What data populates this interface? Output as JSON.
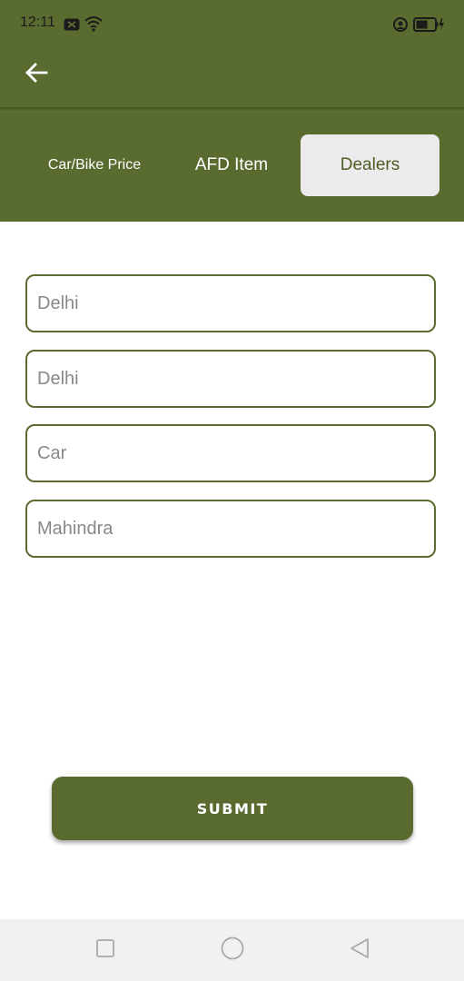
{
  "status_bar": {
    "time": "12:11",
    "icons": [
      "notification-badge-icon",
      "wifi-icon",
      "alarm-icon",
      "battery-icon"
    ]
  },
  "app_bar": {
    "back_icon": "arrow-left-icon"
  },
  "tabs": [
    {
      "label": "Car/Bike Price",
      "selected": false
    },
    {
      "label": "AFD Item",
      "selected": false
    },
    {
      "label": "Dealers",
      "selected": true
    }
  ],
  "form": {
    "fields": [
      {
        "value": "Delhi"
      },
      {
        "value": "Delhi"
      },
      {
        "value": "Car"
      },
      {
        "value": "Mahindra"
      }
    ],
    "submit_label": "SUBMIT"
  },
  "nav_bar": {
    "icons": [
      "recents-square-icon",
      "home-circle-icon",
      "back-triangle-icon"
    ]
  },
  "colors": {
    "primary": "#5a6b30",
    "tab_selected_bg": "#eceaeb",
    "field_text": "#888888",
    "nav_bg": "#f1f1f1"
  }
}
